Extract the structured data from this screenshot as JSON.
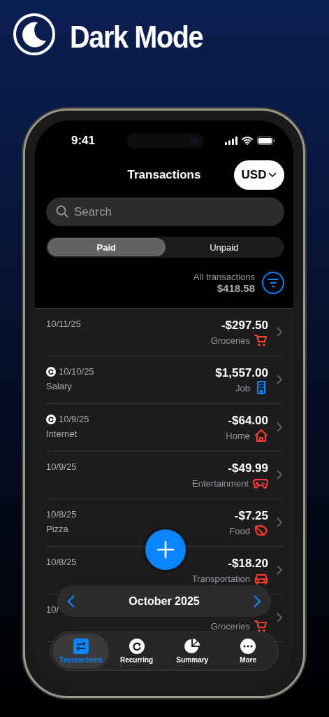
{
  "banner": {
    "title": "Dark Mode"
  },
  "status_bar": {
    "time": "9:41"
  },
  "header": {
    "title": "Transactions",
    "currency": "USD"
  },
  "search": {
    "placeholder": "Search"
  },
  "segments": [
    {
      "label": "Paid",
      "selected": true
    },
    {
      "label": "Unpaid",
      "selected": false
    }
  ],
  "summary": {
    "label": "All transactions",
    "total": "$418.58"
  },
  "transactions": [
    {
      "date": "10/11/25",
      "recurring": false,
      "amount": "-$297.50",
      "category": "Groceries",
      "kind": "cart",
      "color": "#ff3b30"
    },
    {
      "date": "10/10/25",
      "recurring": true,
      "note": "Salary",
      "amount": "$1,557.00",
      "category": "Job",
      "kind": "building",
      "color": "#0a84ff"
    },
    {
      "date": "10/9/25",
      "recurring": true,
      "note": "Internet",
      "amount": "-$64.00",
      "category": "Home",
      "kind": "house",
      "color": "#ff3b30"
    },
    {
      "date": "10/9/25",
      "recurring": false,
      "amount": "-$49.99",
      "category": "Entertainment",
      "kind": "gamepad",
      "color": "#ff3b30"
    },
    {
      "date": "10/8/25",
      "recurring": false,
      "note": "Pizza",
      "amount": "-$7.25",
      "category": "Food",
      "kind": "leaf",
      "color": "#ff3b30"
    },
    {
      "date": "10/8/25",
      "recurring": false,
      "amount": "-$18.20",
      "category": "Transportation",
      "kind": "car",
      "color": "#ff3b30"
    },
    {
      "date": "10/",
      "recurring": false,
      "category": "Groceries",
      "kind": "cart",
      "color": "#ff3b30"
    }
  ],
  "month_bar": {
    "label": "October 2025"
  },
  "tabs": [
    {
      "label": "Transactions",
      "selected": true,
      "kind": "transfer"
    },
    {
      "label": "Recurring",
      "selected": false,
      "kind": "repeat"
    },
    {
      "label": "Summary",
      "selected": false,
      "kind": "pie"
    },
    {
      "label": "More",
      "selected": false,
      "kind": "more"
    }
  ]
}
